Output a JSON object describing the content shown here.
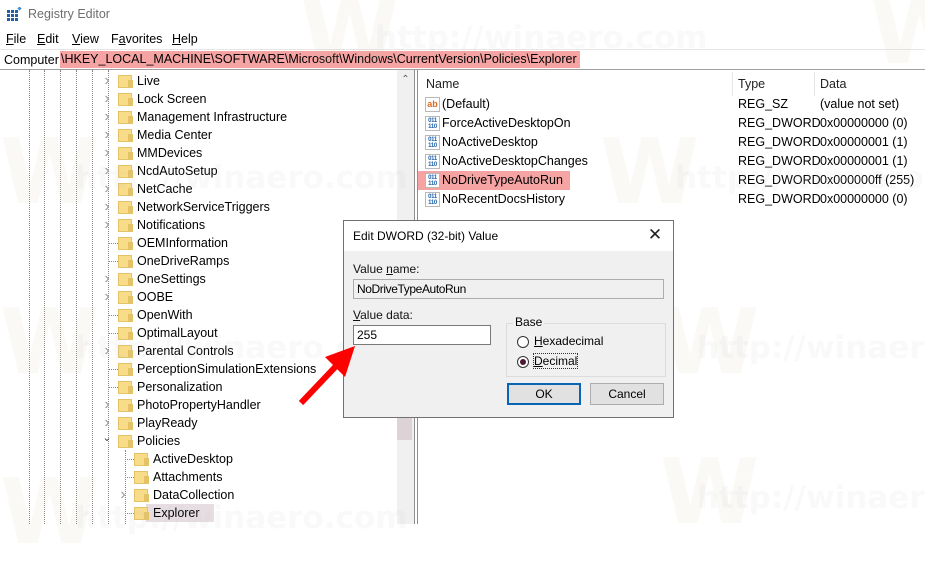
{
  "window": {
    "title": "Registry Editor",
    "icon": "registry-editor-icon"
  },
  "menu": [
    {
      "label": "File",
      "accel": "F"
    },
    {
      "label": "Edit",
      "accel": "E"
    },
    {
      "label": "View",
      "accel": "V"
    },
    {
      "label": "Favorites",
      "accel": "a"
    },
    {
      "label": "Help",
      "accel": "H"
    }
  ],
  "address": {
    "root": "Computer",
    "path": "\\HKEY_LOCAL_MACHINE\\SOFTWARE\\Microsoft\\Windows\\CurrentVersion\\Policies\\Explorer",
    "highlight_color": "#f5a3a3"
  },
  "tree": {
    "items": [
      {
        "label": "Live",
        "expander": "collapsed",
        "level": 0
      },
      {
        "label": "Lock Screen",
        "expander": "collapsed",
        "level": 0
      },
      {
        "label": "Management Infrastructure",
        "expander": "collapsed",
        "level": 0
      },
      {
        "label": "Media Center",
        "expander": "collapsed",
        "level": 0
      },
      {
        "label": "MMDevices",
        "expander": "collapsed",
        "level": 0
      },
      {
        "label": "NcdAutoSetup",
        "expander": "collapsed",
        "level": 0
      },
      {
        "label": "NetCache",
        "expander": "collapsed",
        "level": 0
      },
      {
        "label": "NetworkServiceTriggers",
        "expander": "collapsed",
        "level": 0
      },
      {
        "label": "Notifications",
        "expander": "collapsed",
        "level": 0
      },
      {
        "label": "OEMInformation",
        "expander": "none",
        "level": 0
      },
      {
        "label": "OneDriveRamps",
        "expander": "none",
        "level": 0
      },
      {
        "label": "OneSettings",
        "expander": "collapsed",
        "level": 0
      },
      {
        "label": "OOBE",
        "expander": "collapsed",
        "level": 0
      },
      {
        "label": "OpenWith",
        "expander": "none",
        "level": 0
      },
      {
        "label": "OptimalLayout",
        "expander": "none",
        "level": 0
      },
      {
        "label": "Parental Controls",
        "expander": "collapsed",
        "level": 0
      },
      {
        "label": "PerceptionSimulationExtensions",
        "expander": "none",
        "level": 0
      },
      {
        "label": "Personalization",
        "expander": "none",
        "level": 0
      },
      {
        "label": "PhotoPropertyHandler",
        "expander": "collapsed",
        "level": 0
      },
      {
        "label": "PlayReady",
        "expander": "collapsed",
        "level": 0
      },
      {
        "label": "Policies",
        "expander": "expanded",
        "level": 0
      },
      {
        "label": "ActiveDesktop",
        "expander": "none",
        "level": 1
      },
      {
        "label": "Attachments",
        "expander": "none",
        "level": 1
      },
      {
        "label": "DataCollection",
        "expander": "collapsed",
        "level": 1
      },
      {
        "label": "Explorer",
        "expander": "none",
        "level": 1,
        "selected": true
      }
    ]
  },
  "values": {
    "columns": {
      "name": "Name",
      "type": "Type",
      "data": "Data"
    },
    "rows": [
      {
        "icon": "string-value-icon",
        "name": "(Default)",
        "type": "REG_SZ",
        "data": "(value not set)"
      },
      {
        "icon": "binary-value-icon",
        "name": "ForceActiveDesktopOn",
        "type": "REG_DWORD",
        "data": "0x00000000 (0)"
      },
      {
        "icon": "binary-value-icon",
        "name": "NoActiveDesktop",
        "type": "REG_DWORD",
        "data": "0x00000001 (1)"
      },
      {
        "icon": "binary-value-icon",
        "name": "NoActiveDesktopChanges",
        "type": "REG_DWORD",
        "data": "0x00000001 (1)"
      },
      {
        "icon": "binary-value-icon",
        "name": "NoDriveTypeAutoRun",
        "type": "REG_DWORD",
        "data": "0x000000ff (255)",
        "highlighted": true
      },
      {
        "icon": "binary-value-icon",
        "name": "NoRecentDocsHistory",
        "type": "REG_DWORD",
        "data": "0x00000000 (0)"
      }
    ]
  },
  "dialog": {
    "title": "Edit DWORD (32-bit) Value",
    "value_name_label": {
      "pre": "Value ",
      "accel": "n",
      "post": "ame:"
    },
    "value_name": "NoDriveTypeAutoRun",
    "value_data_label": {
      "pre": "",
      "accel": "V",
      "post": "alue data:"
    },
    "value_data": "255",
    "base_label": "Base",
    "base_options": [
      {
        "accel": "H",
        "rest": "exadecimal",
        "checked": false
      },
      {
        "accel": "D",
        "rest": "ecimal",
        "checked": true
      }
    ],
    "ok_label": "OK",
    "cancel_label": "Cancel"
  },
  "annotation": {
    "arrow_color": "#ff0000",
    "points_to": "value-data-input"
  },
  "watermark": "http://winaero.com"
}
